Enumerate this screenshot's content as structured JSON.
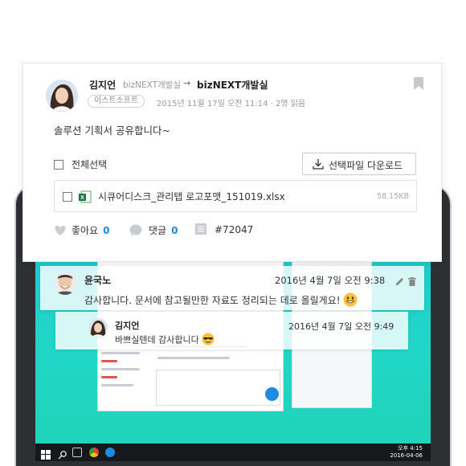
{
  "post": {
    "author": "김지언",
    "author_dept": "bizNEXT개발실",
    "arrow": "→",
    "target": "bizNEXT개발실",
    "company_tag": "이스트소프트",
    "meta": "2015년 11월 17일 오전 11:14 · 2명 읽음",
    "message": "솔루션 기획서 공유합니다~",
    "select_all": "전체선택",
    "download_button": "선택파일 다운로드",
    "file": {
      "name": "시큐어디스크_관리탭 로고포맷_151019.xlsx",
      "size": "58.15KB"
    },
    "actions": {
      "like_label": "좋아요",
      "like_count": "0",
      "comment_label": "댓글",
      "comment_count": "0",
      "tag": "#72047"
    }
  },
  "comments": [
    {
      "author": "윤국노",
      "time": "2016년 4월 7일 오전 9:38",
      "text": "감사합니다. 문서에 참고될만한 자료도 정리되는 데로 올릴게요!"
    },
    {
      "author": "김지언",
      "time": "2016년 4월 7일 오전 9:49",
      "text": "바쁘실텐데 감사합니다"
    }
  ],
  "taskbar": {
    "clock_time": "오후 4:15",
    "clock_date": "2016-04-06"
  },
  "colors": {
    "accent": "#1f8be0",
    "screen_bg": "#1fd0c6"
  },
  "icons": [
    "bookmark-icon",
    "checkbox-icon",
    "download-icon",
    "excel-file-icon",
    "heart-icon",
    "comment-bubble-icon",
    "tag-list-icon",
    "pencil-icon",
    "trash-icon",
    "smile-emoji-icon",
    "sunglasses-emoji-icon"
  ]
}
